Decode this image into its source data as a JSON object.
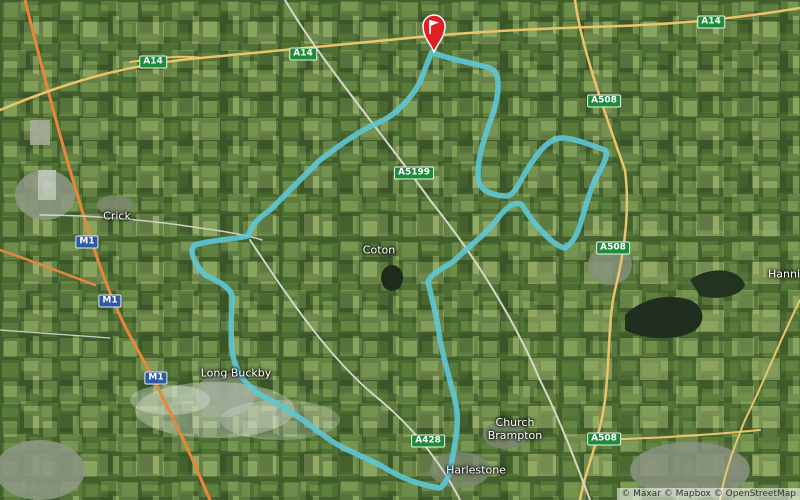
{
  "map": {
    "colors": {
      "route": "#5ec7d6",
      "motorway": "#e8873a",
      "a_road": "#e9c46a",
      "flag": "#e01e25"
    },
    "road_labels": [
      {
        "id": "a14-west",
        "text": "A14",
        "type": "a"
      },
      {
        "id": "a14-mid",
        "text": "A14",
        "type": "a"
      },
      {
        "id": "a14-east",
        "text": "A14",
        "type": "a"
      },
      {
        "id": "a508-north",
        "text": "A508",
        "type": "a"
      },
      {
        "id": "a5199",
        "text": "A5199",
        "type": "a"
      },
      {
        "id": "a508-mid",
        "text": "A508",
        "type": "a"
      },
      {
        "id": "a508-south",
        "text": "A508",
        "type": "a"
      },
      {
        "id": "a428",
        "text": "A428",
        "type": "a"
      },
      {
        "id": "m1-north",
        "text": "M1",
        "type": "motorway"
      },
      {
        "id": "m1-mid",
        "text": "M1",
        "type": "motorway"
      },
      {
        "id": "m1-south",
        "text": "M1",
        "type": "motorway"
      }
    ],
    "place_labels": [
      {
        "id": "crick",
        "text": "Crick"
      },
      {
        "id": "coton",
        "text": "Coton"
      },
      {
        "id": "long-buckby",
        "text": "Long Buckby"
      },
      {
        "id": "church-brampton",
        "text": "Church\nBrampton"
      },
      {
        "id": "harlestone",
        "text": "Harlestone"
      },
      {
        "id": "hanni",
        "text": "Hanni"
      }
    ],
    "start_marker_icon": "flag-icon",
    "attribution": "© Maxar © Mapbox © OpenStreetMap"
  }
}
